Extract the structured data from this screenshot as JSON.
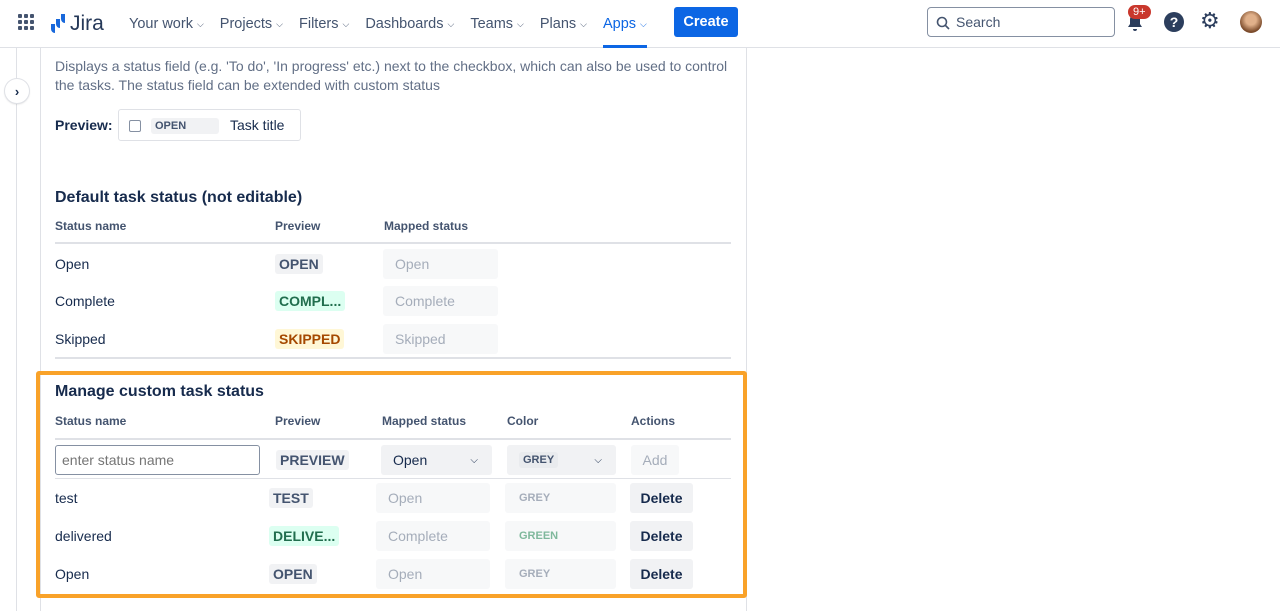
{
  "nav": {
    "logo": "Jira",
    "items": [
      {
        "label": "Your work"
      },
      {
        "label": "Projects"
      },
      {
        "label": "Filters"
      },
      {
        "label": "Dashboards"
      },
      {
        "label": "Teams"
      },
      {
        "label": "Plans"
      },
      {
        "label": "Apps",
        "active": true
      }
    ],
    "create": "Create",
    "search_placeholder": "Search",
    "notification_badge": "9+",
    "accent": "#0c66e4"
  },
  "intro": {
    "description": "Displays a status field (e.g. 'To do', 'In progress' etc.) next to the checkbox, which can also be used to control the tasks. The status field can be extended with custom status",
    "preview_label": "Preview:",
    "preview_status": "OPEN",
    "preview_task": "Task title"
  },
  "default_status": {
    "title": "Default task status (not editable)",
    "headers": [
      "Status name",
      "Preview",
      "Mapped status"
    ],
    "rows": [
      {
        "name": "Open",
        "preview": "OPEN",
        "mapped": "Open",
        "color": "grey"
      },
      {
        "name": "Complete",
        "preview": "COMPL...",
        "mapped": "Complete",
        "color": "green"
      },
      {
        "name": "Skipped",
        "preview": "SKIPPED",
        "mapped": "Skipped",
        "color": "yellow"
      }
    ]
  },
  "custom_status": {
    "title": "Manage custom task status",
    "headers": [
      "Status name",
      "Preview",
      "Mapped status",
      "Color",
      "Actions"
    ],
    "new_row": {
      "placeholder": "enter status name",
      "preview": "PREVIEW",
      "mapped": "Open",
      "color": "GREY",
      "add": "Add"
    },
    "rows": [
      {
        "name": "test",
        "preview": "TEST",
        "mapped": "Open",
        "color": "GREY",
        "action": "Delete"
      },
      {
        "name": "delivered",
        "preview": "DELIVE...",
        "mapped": "Complete",
        "color": "GREEN",
        "action": "Delete"
      },
      {
        "name": "Open",
        "preview": "OPEN",
        "mapped": "Open",
        "color": "GREY",
        "action": "Delete"
      }
    ],
    "highlight_color": "#f9a229"
  }
}
